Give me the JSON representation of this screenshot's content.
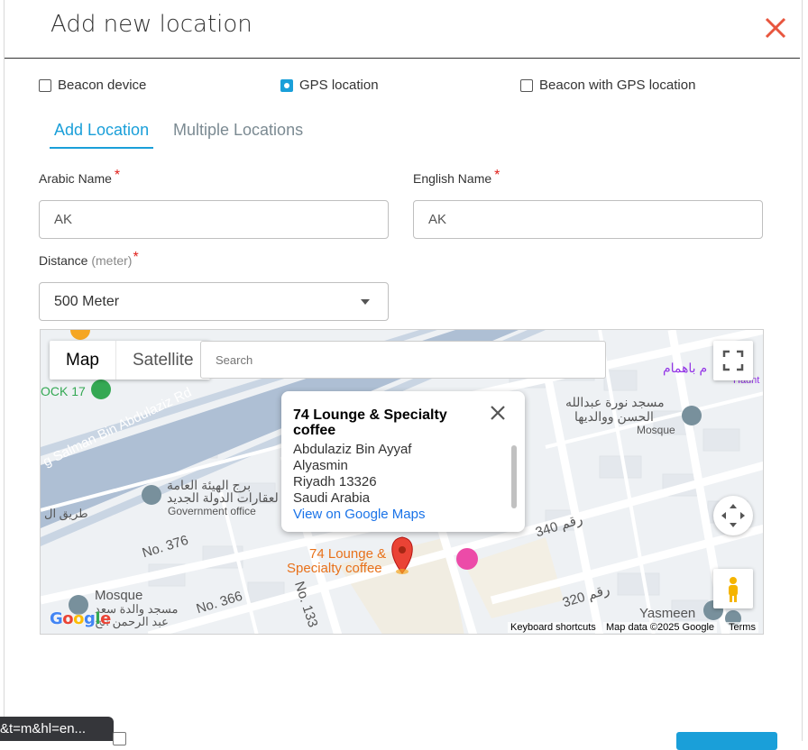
{
  "modal": {
    "title": "Add new location"
  },
  "location_type": {
    "options": [
      {
        "label": "Beacon device",
        "checked": false
      },
      {
        "label": "GPS location",
        "checked": true
      },
      {
        "label": "Beacon with GPS location",
        "checked": false
      }
    ]
  },
  "tabs": [
    {
      "label": "Add Location",
      "active": true
    },
    {
      "label": "Multiple Locations",
      "active": false
    }
  ],
  "form": {
    "arabic_name_label": "Arabic Name",
    "arabic_name_value": "AK",
    "english_name_label": "English Name",
    "english_name_value": "AK",
    "distance_label": "Distance",
    "distance_unit": "(meter)",
    "distance_value": "500 Meter",
    "required_mark": "*"
  },
  "map": {
    "type_map": "Map",
    "type_satellite": "Satellite",
    "search_placeholder": "Search",
    "labels": {
      "road_salman": "g Salman Bin Abdulaziz Rd",
      "no376": "No. 376",
      "no366": "No. 366",
      "no133": "No. 133",
      "r340": "340 رقم",
      "r320": "320 رقم",
      "mosque": "Mosque",
      "mosque2": "Mosque",
      "mosque_ar": "مسجد نورة عبدالله",
      "mosque_ar2": "الحسن ووالديها",
      "gov_ar": "برج الهيئة العامة",
      "gov_ar2": "لعقارات الدولة الجديد",
      "gov": "Government office",
      "place": "74 Lounge &",
      "place2": "Specialty coffee",
      "yasmeen": "Yasmeen",
      "dock": "OCK 17",
      "mosque_walida": "مسجد والدة سعد",
      "mosque_walida2": "عبد الرحمن الح",
      "tariq": "طريق ال",
      "hamam": "م باهمام",
      "haunt": "Haunt"
    },
    "info": {
      "name": "74 Lounge & Specialty coffee",
      "lines": [
        "Abdulaziz Bin Ayyaf",
        "Alyasmin",
        "Riyadh 13326",
        "Saudi Arabia"
      ],
      "link": "View on Google Maps"
    },
    "attribution": {
      "keyboard": "Keyboard shortcuts",
      "data": "Map data ©2025 Google",
      "terms": "Terms"
    },
    "logo": "Google"
  },
  "status_tip": "&t=m&hl=en..."
}
